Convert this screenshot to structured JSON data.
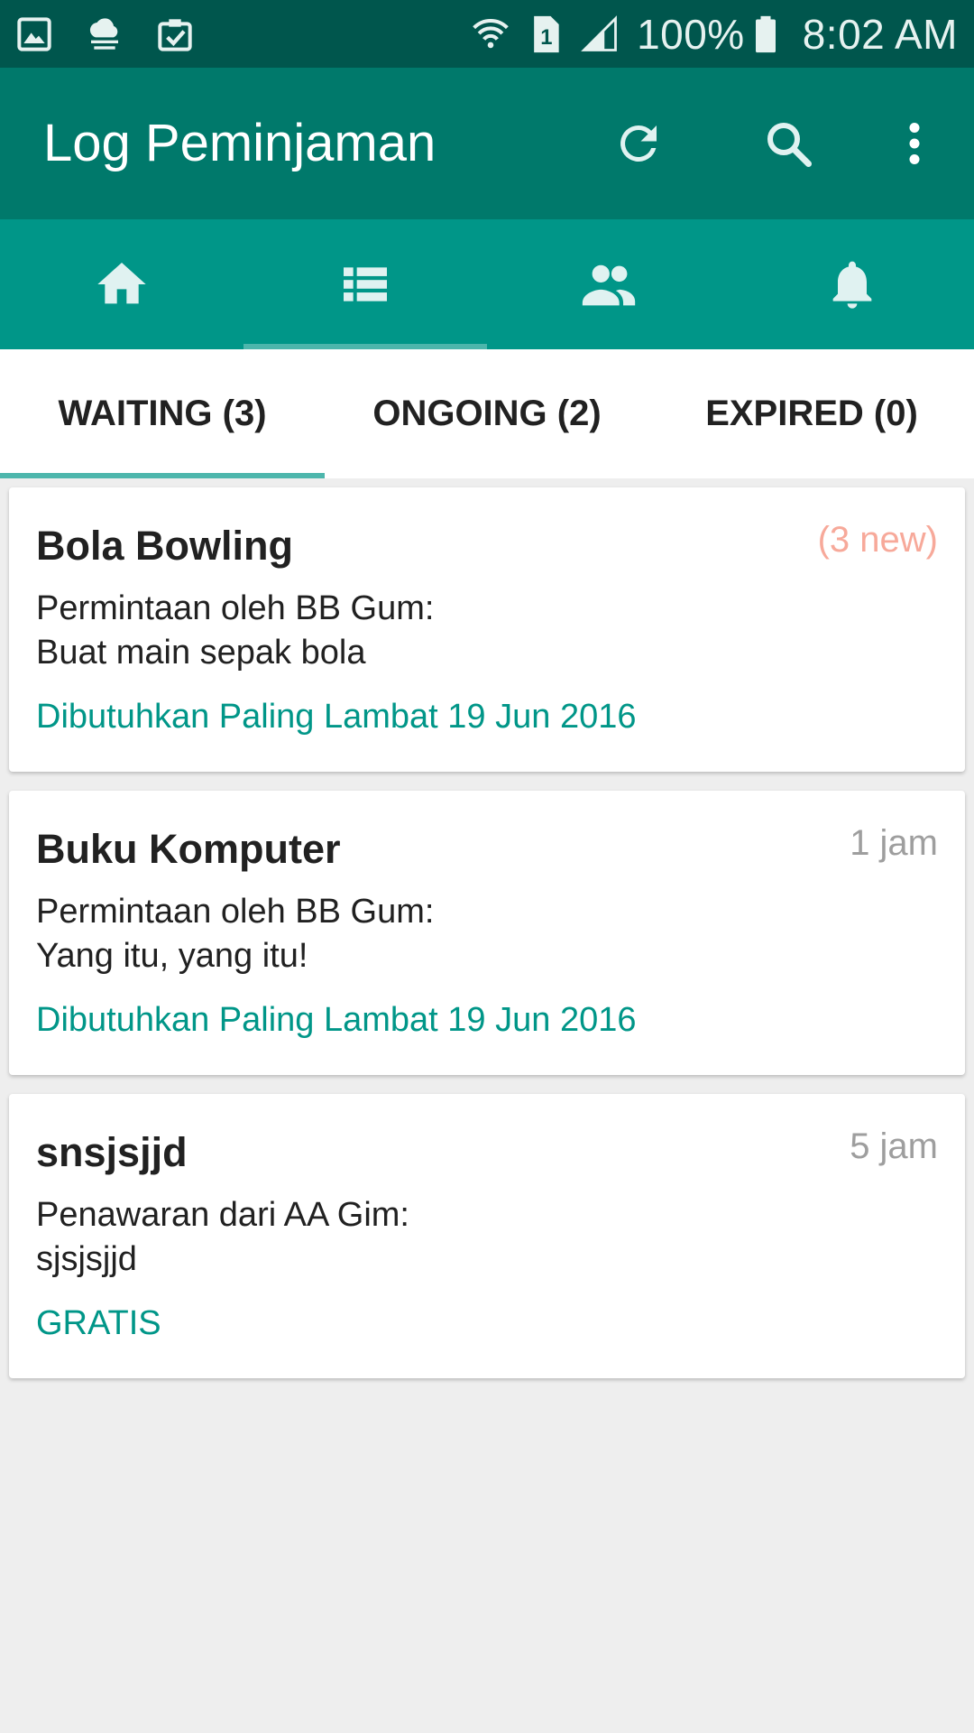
{
  "status_bar": {
    "battery": "100%",
    "time": "8:02 AM",
    "sim_slot": "1"
  },
  "app_bar": {
    "title": "Log Peminjaman",
    "actions": [
      "refresh-icon",
      "search-icon",
      "more-vert-icon"
    ]
  },
  "nav_tabs": [
    {
      "icon": "home-icon",
      "selected": false
    },
    {
      "icon": "list-icon",
      "selected": true
    },
    {
      "icon": "people-icon",
      "selected": false
    },
    {
      "icon": "bell-icon",
      "selected": false
    }
  ],
  "tabs": [
    {
      "label": "WAITING (3)",
      "selected": true
    },
    {
      "label": "ONGOING (2)",
      "selected": false
    },
    {
      "label": "EXPIRED (0)",
      "selected": false
    }
  ],
  "items": [
    {
      "title": "Bola Bowling",
      "meta": "(3 new)",
      "line1": "Permintaan oleh BB Gum:",
      "line2": "Buat main sepak bola",
      "footer": "Dibutuhkan Paling Lambat 19 Jun 2016"
    },
    {
      "title": "Buku Komputer",
      "meta": "1 jam",
      "line1": "Permintaan oleh BB Gum:",
      "line2": "Yang itu, yang itu!",
      "footer": "Dibutuhkan Paling Lambat 19 Jun 2016"
    },
    {
      "title": "snsjsjjd",
      "meta": "5 jam",
      "line1": "Penawaran dari AA Gim:",
      "line2": "sjsjsjjd",
      "footer": "GRATIS"
    }
  ],
  "colors": {
    "status_bar": "#00564d",
    "app_bar": "#00796b",
    "nav_bar": "#009688",
    "accent": "#009688",
    "indicator": "#4db6ac",
    "new_badge": "#f7a99a"
  }
}
